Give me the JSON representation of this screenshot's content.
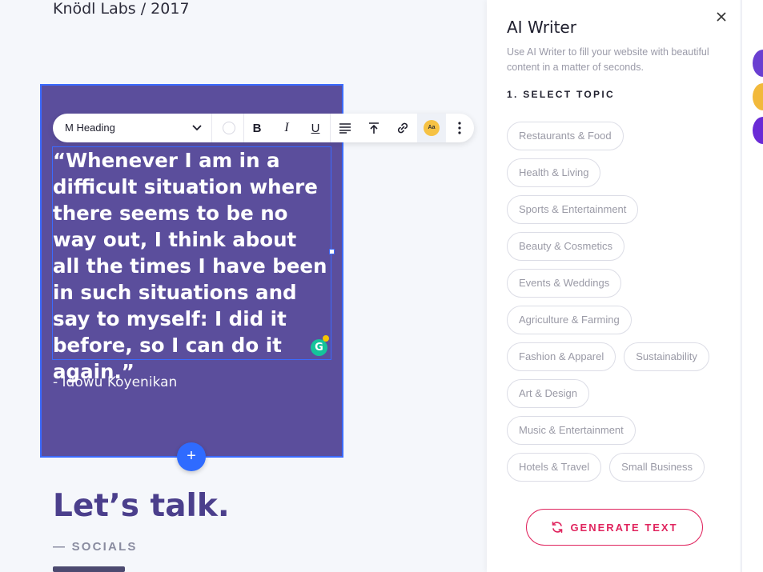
{
  "canvas": {
    "caption": "Knödl Labs / 2017",
    "quote": "“Whenever I am in a difficult situation where there seems to be no way out, I think about all the times I have been in such situations and say to myself: I did it before, so I can do it again.”",
    "author": "- Idowu Koyenikan",
    "add_button": "+",
    "talk_title": "Let’s talk.",
    "socials_label": "— SOCIALS"
  },
  "toolbar": {
    "text_style": "M Heading",
    "bold": "B",
    "italic": "I",
    "underline": "U",
    "ai_badge": "Aa"
  },
  "grammarly": "G",
  "panel": {
    "title": "AI Writer",
    "description": "Use AI Writer to fill your website with beautiful content in a matter of seconds.",
    "step_label": "1. SELECT TOPIC",
    "topics": [
      [
        "Restaurants & Food"
      ],
      [
        "Health & Living"
      ],
      [
        "Sports & Entertainment"
      ],
      [
        "Beauty & Cosmetics"
      ],
      [
        "Events & Weddings"
      ],
      [
        "Agriculture & Farming"
      ],
      [
        "Fashion & Apparel",
        "Sustainability"
      ],
      [
        "Art & Design"
      ],
      [
        "Music & Entertainment"
      ],
      [
        "Hotels & Travel",
        "Small Business"
      ]
    ],
    "generate_label": "GENERATE TEXT"
  },
  "colors": {
    "quote_bg": "#5b4e9c",
    "selection": "#3b6bff",
    "accent_pink": "#e0245e",
    "title_purple": "#4b3f8c"
  }
}
